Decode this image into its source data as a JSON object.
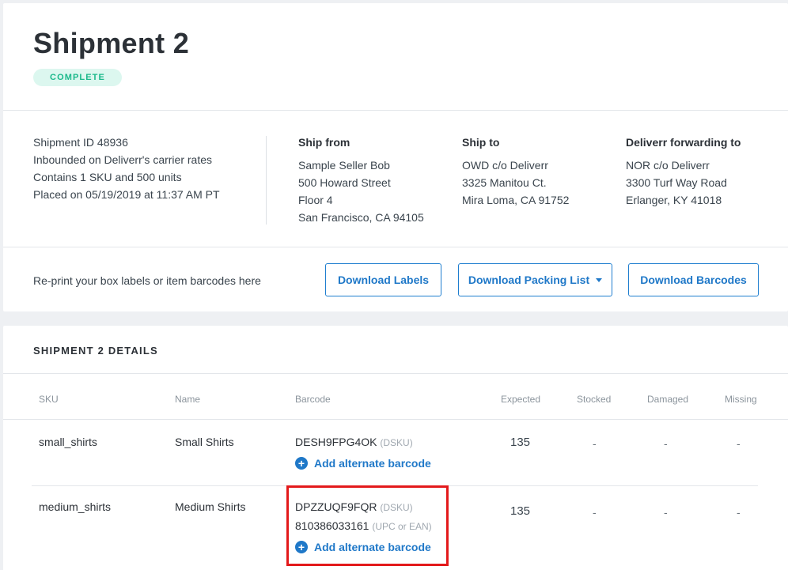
{
  "header": {
    "title": "Shipment 2",
    "status": "COMPLETE"
  },
  "summary": {
    "lines": [
      "Shipment ID 48936",
      "Inbounded on Deliverr's carrier rates",
      "Contains 1 SKU and 500 units",
      "Placed on 05/19/2019 at 11:37 AM PT"
    ]
  },
  "ship_from": {
    "heading": "Ship from",
    "lines": [
      "Sample Seller Bob",
      "500 Howard Street",
      "Floor 4",
      "San Francisco, CA 94105"
    ]
  },
  "ship_to": {
    "heading": "Ship to",
    "lines": [
      "OWD c/o Deliverr",
      "3325 Manitou Ct.",
      "Mira Loma, CA 91752"
    ]
  },
  "forwarding": {
    "heading": "Deliverr forwarding to",
    "lines": [
      "NOR c/o Deliverr",
      "3300 Turf Way Road",
      "Erlanger, KY 41018"
    ]
  },
  "reprint": {
    "text": "Re-print your box labels or item barcodes here",
    "download_labels": "Download Labels",
    "download_packing_list": "Download Packing List",
    "download_barcodes": "Download Barcodes"
  },
  "details": {
    "title": "SHIPMENT 2 DETAILS",
    "columns": [
      "SKU",
      "Name",
      "Barcode",
      "Expected",
      "Stocked",
      "Damaged",
      "Missing"
    ],
    "add_barcode_label": "Add alternate barcode",
    "rows": [
      {
        "sku": "small_shirts",
        "name": "Small Shirts",
        "barcodes": [
          {
            "code": "DESH9FPG4OK",
            "type": "(DSKU)"
          }
        ],
        "expected": "135",
        "stocked": "-",
        "damaged": "-",
        "missing": "-"
      },
      {
        "sku": "medium_shirts",
        "name": "Medium Shirts",
        "barcodes": [
          {
            "code": "DPZZUQF9FQR",
            "type": "(DSKU)"
          },
          {
            "code": "810386033161",
            "type": "(UPC or EAN)"
          }
        ],
        "expected": "135",
        "stocked": "-",
        "damaged": "-",
        "missing": "-"
      }
    ]
  },
  "colors": {
    "accent": "#1f78c8",
    "status_bg": "#dcf7ef",
    "status_text": "#1bb98b",
    "highlight": "#e3191b"
  }
}
